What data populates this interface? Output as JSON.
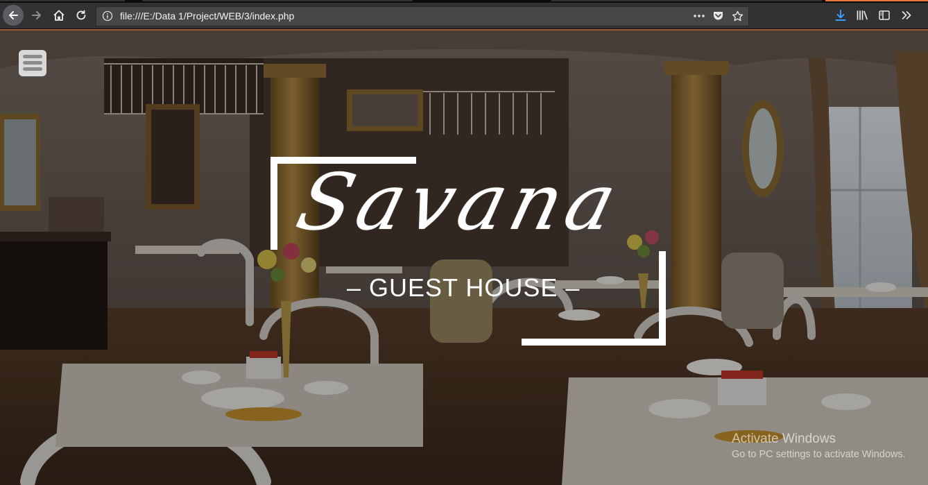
{
  "browser": {
    "url": "file:///E:/Data 1/Project/WEB/3/index.php",
    "page_actions_icon": "ellipsis-icon",
    "pocket_icon": "pocket-icon",
    "bookmark_icon": "star-icon",
    "right_icons": [
      "download-icon",
      "library-icon",
      "sidebar-icon",
      "overflow-chevron-icon"
    ],
    "accent_color": "#3b9bff"
  },
  "page": {
    "menu_icon": "hamburger-icon",
    "logo": {
      "script_text": "Savana",
      "tagline": "– GUEST HOUSE –",
      "color": "#ffffff"
    },
    "background_photo": "guest house dining room"
  },
  "os_watermark": {
    "title": "Activate Windows",
    "subtitle": "Go to PC settings to activate Windows."
  }
}
